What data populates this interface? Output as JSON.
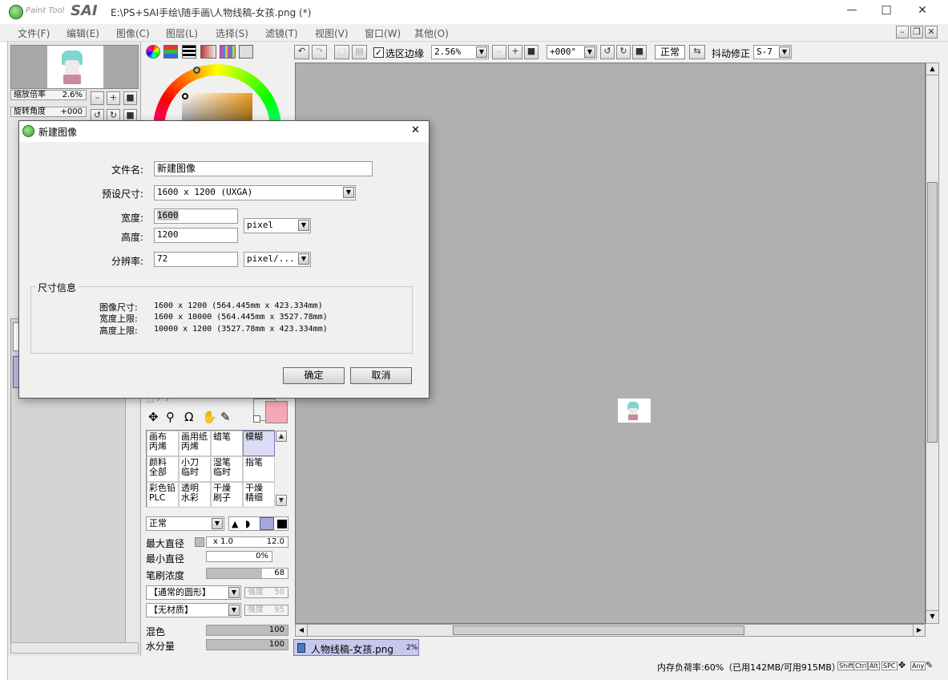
{
  "app": {
    "logo_text_small": "Paint Tool",
    "logo_text": "SAI",
    "title": "E:\\PS+SAI手绘\\随手画\\人物线稿-女孩.png (*)"
  },
  "window_controls": {
    "minimize": "—",
    "maximize": "☐",
    "close": "✕"
  },
  "menu": [
    {
      "label": "文件(F)"
    },
    {
      "label": "编辑(E)"
    },
    {
      "label": "图像(C)"
    },
    {
      "label": "图层(L)"
    },
    {
      "label": "选择(S)"
    },
    {
      "label": "滤镜(T)"
    },
    {
      "label": "视图(V)"
    },
    {
      "label": "窗口(W)"
    },
    {
      "label": "其他(O)"
    }
  ],
  "navigator": {
    "zoom_label": "缩放倍率",
    "zoom_value": "2.6%",
    "rotate_label": "旋转角度",
    "rotate_value": "+000"
  },
  "toolbar": {
    "selection_edge_label": "选区边缘",
    "selection_edge_checked": true,
    "zoom_value": "2.56%",
    "rotation_value": "+000°",
    "mode_value": "正常",
    "stabilizer_label": "抖动修正",
    "stabilizer_value": "S-7"
  },
  "brushes": [
    {
      "line1": "画布",
      "line2": "丙烯"
    },
    {
      "line1": "画用纸",
      "line2": "丙烯"
    },
    {
      "line1": "蜡笔",
      "line2": ""
    },
    {
      "line1": "模糊",
      "line2": ""
    },
    {
      "line1": "颜料",
      "line2": "全部"
    },
    {
      "line1": "小刀",
      "line2": "临时"
    },
    {
      "line1": "湿笔",
      "line2": "临时"
    },
    {
      "line1": "指笔",
      "line2": ""
    },
    {
      "line1": "彩色铅",
      "line2": "PLC"
    },
    {
      "line1": "透明",
      "line2": "水彩"
    },
    {
      "line1": "干燥",
      "line2": "刷子"
    },
    {
      "line1": "干燥",
      "line2": "精细"
    }
  ],
  "brush_settings": {
    "blend_mode": "正常",
    "max_size_label": "最大直径",
    "max_size_mult": "x 1.0",
    "max_size_value": "12.0",
    "min_size_label": "最小直径",
    "min_size_value": "0%",
    "min_size_fraction": 0,
    "density_label": "笔刷浓度",
    "density_value": "68",
    "density_fraction": 0.68,
    "shape_value": "【通常的圆形】",
    "shape_strength_label": "强度",
    "shape_strength_value": "50",
    "texture_value": "【无材质】",
    "texture_strength_label": "强度",
    "texture_strength_value": "95",
    "blending_label": "混色",
    "blending_value": "100",
    "dilution_label": "水分量",
    "dilution_value": "100"
  },
  "document_tab": {
    "name": "人物线稿-女孩.png",
    "zoom": "2%"
  },
  "status": {
    "memory": "内存负荷率:60%（已用142MB/可用915MB）",
    "keys": [
      "Shift",
      "Ctrl",
      "Alt",
      "SPC",
      "Any"
    ]
  },
  "dialog": {
    "title": "新建图像",
    "close": "✕",
    "filename_label": "文件名:",
    "filename_value": "新建图像",
    "preset_label": "预设尺寸:",
    "preset_value": "1600 x 1200 (UXGA)",
    "width_label": "宽度:",
    "width_value": "1600",
    "height_label": "高度:",
    "height_value": "1200",
    "size_unit": "pixel",
    "resolution_label": "分辨率:",
    "resolution_value": "72",
    "resolution_unit": "pixel/...",
    "info_title": "尺寸信息",
    "info_rows": [
      {
        "label": "图像尺寸:",
        "value": "1600 x 1200 (564.445mm x 423.334mm)"
      },
      {
        "label": "宽度上限:",
        "value": "1600 x 10000 (564.445mm x 3527.78mm)"
      },
      {
        "label": "高度上限:",
        "value": "10000 x 1200 (3527.78mm x 423.334mm)"
      }
    ],
    "ok_label": "确定",
    "cancel_label": "取消"
  },
  "colors": {
    "primary": "#f4aab4",
    "secondary": "#f0f0f0",
    "canvas_bg": "#b0b0b0",
    "selected_brush": "#dcdcf4"
  }
}
